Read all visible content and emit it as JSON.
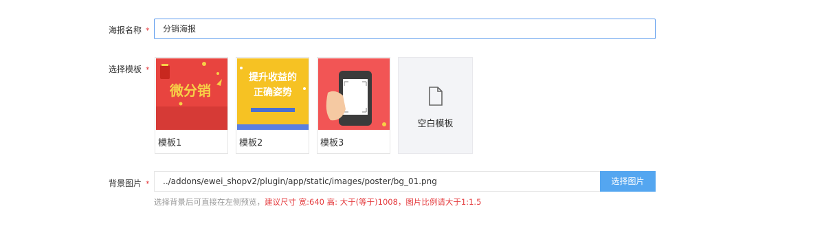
{
  "form": {
    "poster_name": {
      "label": "海报名称",
      "required_mark": "*",
      "value": "分销海报"
    },
    "template": {
      "label": "选择模板",
      "required_mark": "*",
      "items": [
        {
          "name": "模板1",
          "thumb_text": "微分销",
          "thumb_color": "#e8443f"
        },
        {
          "name": "模板2",
          "thumb_text_line1": "提升收益的",
          "thumb_text_line2": "正确姿势",
          "thumb_color": "#f6c223"
        },
        {
          "name": "模板3",
          "thumb_color": "#f25555"
        }
      ],
      "blank": {
        "label": "空白模板",
        "icon": "file-icon"
      }
    },
    "background": {
      "label": "背景图片",
      "required_mark": "*",
      "value": "../addons/ewei_shopv2/plugin/app/static/images/poster/bg_01.png",
      "button_label": "选择图片",
      "hint_muted": "选择背景后可直接在左侧预览，",
      "hint_warn": "建议尺寸 宽:640 高: 大于(等于)1008，图片比例请大于1:1.5"
    }
  },
  "colors": {
    "accent": "#54a6f0",
    "required": "#e4393c",
    "input_focus_border": "#5c9bed"
  }
}
